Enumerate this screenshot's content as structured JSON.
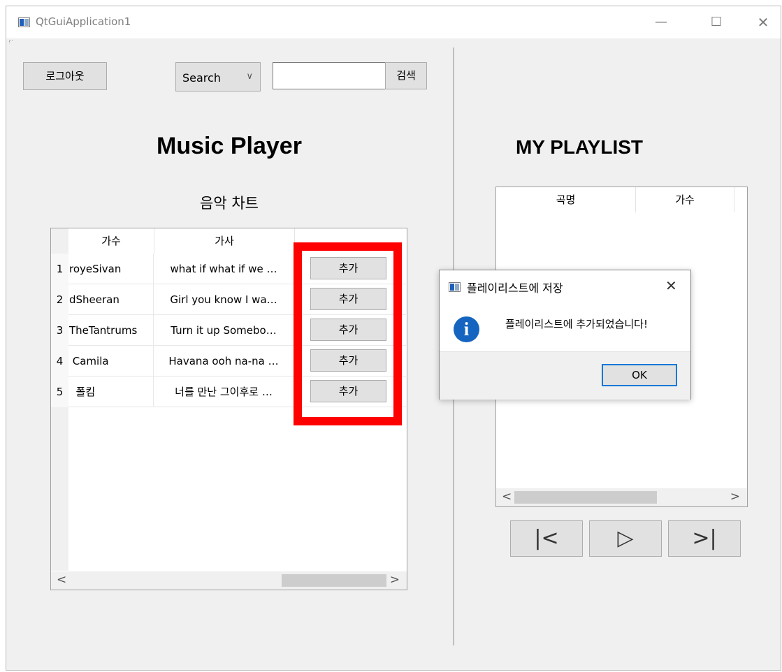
{
  "window": {
    "title": "QtGuiApplication1"
  },
  "toolbar": {
    "logout_label": "로그아웃",
    "search_combo_value": "Search",
    "search_input_value": "",
    "search_button_label": "검색"
  },
  "main": {
    "title": "Music Player",
    "chart_subtitle": "음악 차트",
    "columns": [
      "가수",
      "가사",
      ""
    ],
    "rows": [
      {
        "index": "1",
        "singer": "royeSivan",
        "lyrics": "what if what if we …",
        "button": "추가"
      },
      {
        "index": "2",
        "singer": "dSheeran",
        "lyrics": "Girl you know I wa…",
        "button": "추가"
      },
      {
        "index": "3",
        "singer": "TheTantrums",
        "lyrics": "Turn it up Somebo…",
        "button": "추가"
      },
      {
        "index": "4",
        "singer": " Camila",
        "lyrics": "Havana ooh na-na …",
        "button": "추가"
      },
      {
        "index": "5",
        "singer": "  폴킴",
        "lyrics": "너를 만난 그이후로 …",
        "button": "추가"
      }
    ]
  },
  "playlist": {
    "title": "MY PLAYLIST",
    "columns": [
      "곡명",
      "가수"
    ]
  },
  "player": {
    "prev_icon": "|<",
    "play_icon": "▷",
    "next_icon": ">|"
  },
  "dialog": {
    "title": "플레이리스트에 저장",
    "message": "플레이리스트에 추가되었습니다!",
    "ok_label": "OK"
  },
  "colors": {
    "highlight": "#ff0000",
    "dialog_ok_border": "#0078d7",
    "info_icon": "#1565c0"
  }
}
